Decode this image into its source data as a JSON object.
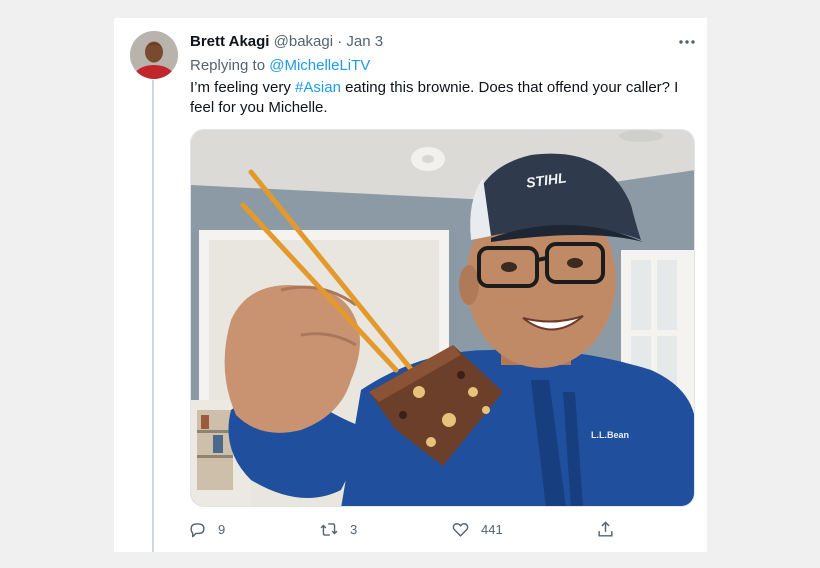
{
  "tweet": {
    "author_name": "Brett Akagi",
    "handle": "@bakagi",
    "separator": "·",
    "date": "Jan 3",
    "replying_prefix": "Replying to",
    "replying_to": "@MichelleLiTV",
    "text_before": "I’m feeling very ",
    "hashtag": "#Asian",
    "text_after": " eating this brownie. Does that offend your caller? I feel for you Michelle.",
    "more_icon": "more-horizontal-icon"
  },
  "photo": {
    "cap_text": "STIHL",
    "jacket_logo": "L.L.Bean"
  },
  "actions": {
    "replies": "9",
    "retweets": "3",
    "likes": "441"
  },
  "colors": {
    "link": "#1d9bf0",
    "text": "#0f1419",
    "muted": "#536471",
    "background": "#f0f0f0"
  }
}
